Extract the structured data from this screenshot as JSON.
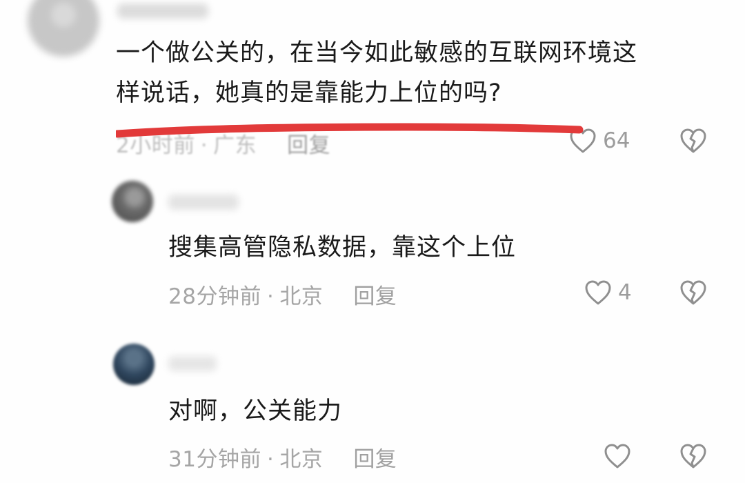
{
  "comments": [
    {
      "text_lines": [
        "一个做公关的，在当今如此敏感的互联网环境这",
        "样说话，她真的是靠能力上位的吗?"
      ],
      "time": "2小时前",
      "separator": "·",
      "location": "广东",
      "reply_label": "回复",
      "likes": "64"
    },
    {
      "text_lines": [
        "搜集高管隐私数据，靠这个上位"
      ],
      "time": "28分钟前",
      "separator": "·",
      "location": "北京",
      "reply_label": "回复",
      "likes": "4"
    },
    {
      "text_lines": [
        "对啊，公关能力"
      ],
      "time": "31分钟前",
      "separator": "·",
      "location": "北京",
      "reply_label": "回复",
      "likes": ""
    }
  ],
  "icons": {
    "like": "heart-outline-icon",
    "dislike": "broken-heart-icon"
  },
  "colors": {
    "annotation_stroke": "#e23a3a",
    "meta_text": "#a5a5a5",
    "body_text": "#1a1a1a"
  }
}
